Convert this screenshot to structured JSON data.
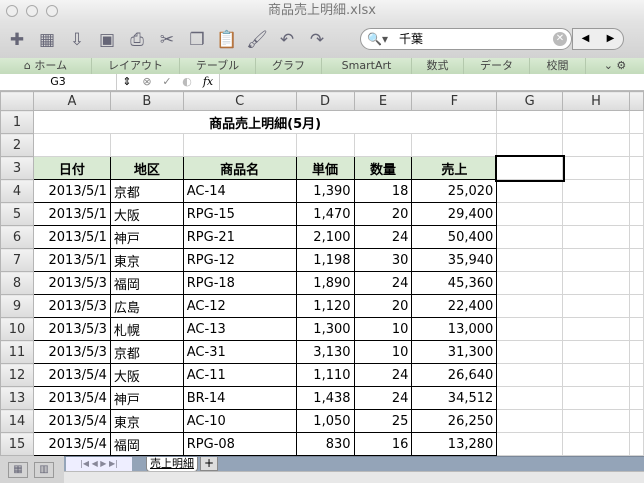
{
  "window": {
    "title": "商品売上明細.xlsx"
  },
  "search": {
    "value": "千葉"
  },
  "ribbon": {
    "tabs": [
      "ホーム",
      "レイアウト",
      "テーブル",
      "グラフ",
      "SmartArt",
      "数式",
      "データ",
      "校閲"
    ]
  },
  "formula_bar": {
    "name_box": "G3",
    "fx": "fx",
    "value": ""
  },
  "columns": [
    "A",
    "B",
    "C",
    "D",
    "E",
    "F",
    "G",
    "H"
  ],
  "sheet": {
    "title": "商品売上明細(5月)",
    "headers": [
      "日付",
      "地区",
      "商品名",
      "単価",
      "数量",
      "売上"
    ],
    "rows": [
      [
        "2013/5/1",
        "京都",
        "AC-14",
        "1,390",
        "18",
        "25,020"
      ],
      [
        "2013/5/1",
        "大阪",
        "RPG-15",
        "1,470",
        "20",
        "29,400"
      ],
      [
        "2013/5/1",
        "神戸",
        "RPG-21",
        "2,100",
        "24",
        "50,400"
      ],
      [
        "2013/5/1",
        "東京",
        "RPG-12",
        "1,198",
        "30",
        "35,940"
      ],
      [
        "2013/5/3",
        "福岡",
        "RPG-18",
        "1,890",
        "24",
        "45,360"
      ],
      [
        "2013/5/3",
        "広島",
        "AC-12",
        "1,120",
        "20",
        "22,400"
      ],
      [
        "2013/5/3",
        "札幌",
        "AC-13",
        "1,300",
        "10",
        "13,000"
      ],
      [
        "2013/5/3",
        "京都",
        "AC-31",
        "3,130",
        "10",
        "31,300"
      ],
      [
        "2013/5/4",
        "大阪",
        "AC-11",
        "1,110",
        "24",
        "26,640"
      ],
      [
        "2013/5/4",
        "神戸",
        "BR-14",
        "1,438",
        "24",
        "34,512"
      ],
      [
        "2013/5/4",
        "東京",
        "AC-10",
        "1,050",
        "25",
        "26,250"
      ],
      [
        "2013/5/4",
        "福岡",
        "RPG-08",
        "830",
        "16",
        "13,280"
      ]
    ]
  },
  "sheet_tabs": {
    "active": "売上明細",
    "add": "+"
  }
}
